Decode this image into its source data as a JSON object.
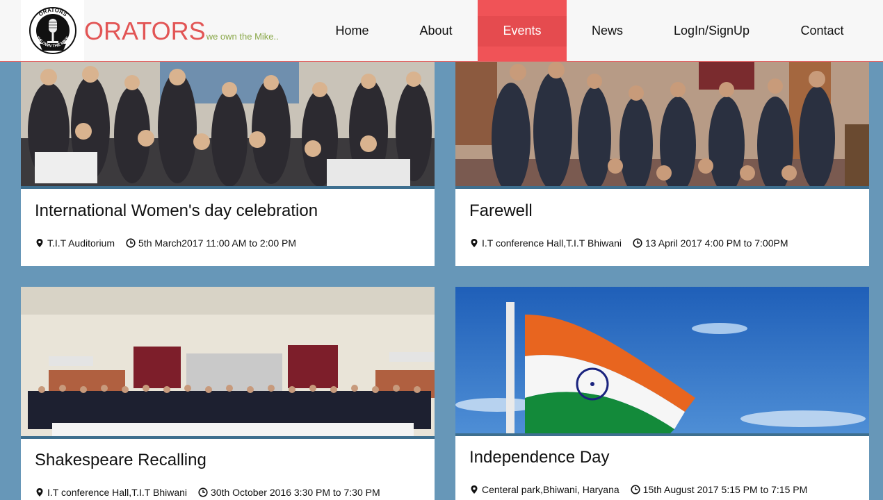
{
  "header": {
    "logo_text_top": "ORATORS",
    "logo_text_bottom": "WE OWN THE MIKE",
    "brand_name": "ORATORS",
    "tagline": "we own the Mike.."
  },
  "nav": {
    "items": [
      {
        "label": "Home"
      },
      {
        "label": "About"
      },
      {
        "label": "Events",
        "active": true
      },
      {
        "label": "News"
      },
      {
        "label": "LogIn/SignUp"
      },
      {
        "label": "Contact"
      }
    ]
  },
  "colors": {
    "page_bg": "#6797b8",
    "brand": "#e25555",
    "tagline": "#8aa84a",
    "nav_active": "#f05357"
  },
  "events": [
    {
      "title": "International Women's day celebration",
      "venue": "T.I.T Auditorium",
      "time": "5th March2017 11:00 AM to 2:00 PM",
      "venue_icon": "map-marker-icon",
      "time_icon": "clock-icon"
    },
    {
      "title": "Farewell",
      "venue": "I.T conference Hall,T.I.T Bhiwani",
      "time": "13 April 2017 4:00 PM to 7:00PM",
      "venue_icon": "map-marker-icon",
      "time_icon": "clock-icon"
    },
    {
      "title": "Shakespeare Recalling",
      "venue": "I.T conference Hall,T.I.T Bhiwani",
      "time": "30th October 2016 3:30 PM to 7:30 PM",
      "venue_icon": "map-marker-icon",
      "time_icon": "clock-icon"
    },
    {
      "title": "Independence Day",
      "venue": "Centeral park,Bhiwani, Haryana",
      "time": "15th August 2017 5:15 PM to 7:15 PM",
      "venue_icon": "map-marker-icon",
      "time_icon": "clock-icon"
    }
  ]
}
